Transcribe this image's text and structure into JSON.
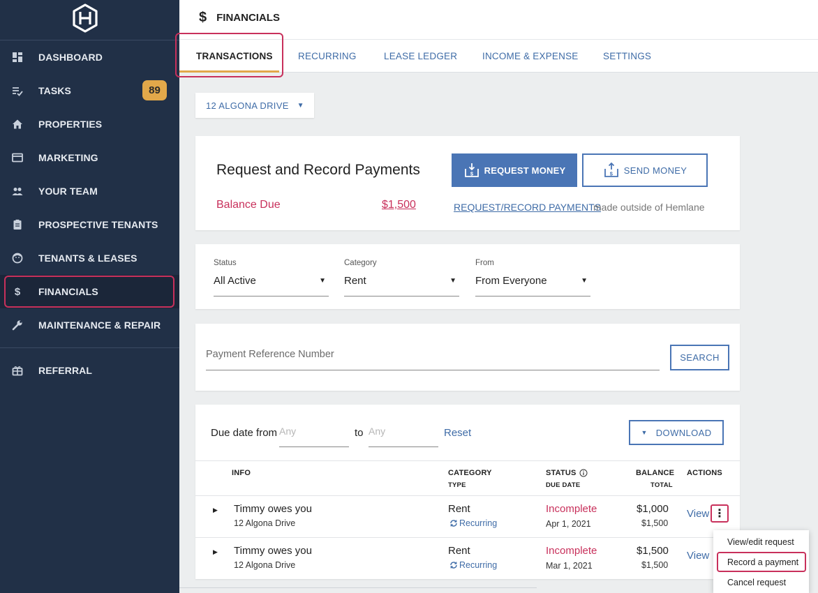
{
  "sidebar": {
    "items": [
      {
        "label": "DASHBOARD",
        "icon": "dashboard-icon"
      },
      {
        "label": "TASKS",
        "icon": "tasks-icon",
        "badge": "89"
      },
      {
        "label": "PROPERTIES",
        "icon": "home-icon"
      },
      {
        "label": "MARKETING",
        "icon": "marketing-icon"
      },
      {
        "label": "YOUR TEAM",
        "icon": "team-icon"
      },
      {
        "label": "PROSPECTIVE TENANTS",
        "icon": "clipboard-icon"
      },
      {
        "label": "TENANTS & LEASES",
        "icon": "tenants-icon"
      },
      {
        "label": "FINANCIALS",
        "icon": "dollar-icon"
      },
      {
        "label": "MAINTENANCE & REPAIR",
        "icon": "wrench-icon"
      },
      {
        "label": "REFERRAL",
        "icon": "gift-icon"
      }
    ]
  },
  "header": {
    "icon": "$",
    "title": "FINANCIALS",
    "tabs": [
      "TRANSACTIONS",
      "RECURRING",
      "LEASE LEDGER",
      "INCOME & EXPENSE",
      "SETTINGS"
    ]
  },
  "property_selector": {
    "value": "12 ALGONA DRIVE"
  },
  "request_card": {
    "title": "Request and Record Payments",
    "balance_label": "Balance Due",
    "balance_value": "$1,500",
    "request_money_label": "REQUEST MONEY",
    "send_money_label": "SEND MONEY",
    "link_text": "REQUEST/RECORD PAYMENTS",
    "link_suffix": "made outside of Hemlane"
  },
  "filters": [
    {
      "label": "Status",
      "value": "All Active"
    },
    {
      "label": "Category",
      "value": "Rent"
    },
    {
      "label": "From",
      "value": "From Everyone"
    }
  ],
  "search": {
    "placeholder": "Payment Reference Number",
    "button_label": "SEARCH"
  },
  "transactions": {
    "due_date_label": "Due date from",
    "from_placeholder": "Any",
    "to_label": "to",
    "to_placeholder": "Any",
    "reset_label": "Reset",
    "download_label": "DOWNLOAD",
    "headers": {
      "info": "INFO",
      "category": "CATEGORY",
      "type": "TYPE",
      "status": "STATUS",
      "due_date": "DUE DATE",
      "balance": "BALANCE",
      "total": "TOTAL",
      "actions": "ACTIONS"
    },
    "rows": [
      {
        "title": "Timmy owes you",
        "address": "12 Algona Drive",
        "category": "Rent",
        "type": "Recurring",
        "status": "Incomplete",
        "due_date": "Apr 1, 2021",
        "balance": "$1,000",
        "total": "$1,500",
        "action": "View"
      },
      {
        "title": "Timmy owes you",
        "address": "12 Algona Drive",
        "category": "Rent",
        "type": "Recurring",
        "status": "Incomplete",
        "due_date": "Mar 1, 2021",
        "balance": "$1,500",
        "total": "$1,500",
        "action": "View"
      }
    ]
  },
  "action_menu": {
    "items": [
      "View/edit request",
      "Record a payment",
      "Cancel request"
    ]
  },
  "colors": {
    "sidebar_bg": "#213047",
    "accent_blue": "#4a75b5",
    "alert_red": "#c8305b",
    "badge_orange": "#e2a84a"
  }
}
